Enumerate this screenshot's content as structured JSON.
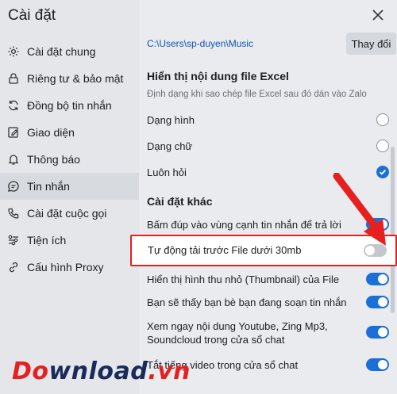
{
  "sidebar": {
    "title": "Cài đặt",
    "items": [
      {
        "label": "Cài đặt chung",
        "icon": "gear-icon"
      },
      {
        "label": "Riêng tư & bảo mật",
        "icon": "lock-icon"
      },
      {
        "label": "Đồng bộ tin nhắn",
        "icon": "sync-icon"
      },
      {
        "label": "Giao diện",
        "icon": "edit-icon"
      },
      {
        "label": "Thông báo",
        "icon": "bell-icon"
      },
      {
        "label": "Tin nhắn",
        "icon": "chat-icon",
        "active": true
      },
      {
        "label": "Cài đặt cuộc gọi",
        "icon": "phone-icon"
      },
      {
        "label": "Tiện ích",
        "icon": "utilities-icon"
      },
      {
        "label": "Cấu hình Proxy",
        "icon": "proxy-icon"
      }
    ]
  },
  "main": {
    "path": "C:\\Users\\sp-duyen\\Music",
    "change_button": "Thay đổi",
    "excel": {
      "title": "Hiển thị nội dung file Excel",
      "desc": "Định dạng khi sao chép file Excel sau đó dán vào Zalo",
      "options": [
        {
          "label": "Dạng hình",
          "checked": false
        },
        {
          "label": "Dạng chữ",
          "checked": false
        },
        {
          "label": "Luôn hỏi",
          "checked": true
        }
      ]
    },
    "other": {
      "title": "Cài đặt khác",
      "items": [
        {
          "label": "Bấm đúp vào vùng cạnh tin nhắn để trả lời",
          "on": true
        },
        {
          "label": "Tự động tải trước File dưới 30mb",
          "on": false
        },
        {
          "label": "Hiển thị hình thu nhỏ (Thumbnail) của File",
          "on": true
        },
        {
          "label": "Bạn sẽ thấy bạn bè bạn đang soạn tin nhắn",
          "on": true
        },
        {
          "label_line1": "Xem ngay nội dung Youtube, Zing Mp3,",
          "label_line2": "Soundcloud trong cửa sổ chat",
          "on": true
        },
        {
          "label": "Tắt tiếng video trong cửa sổ chat",
          "on": true
        }
      ]
    }
  },
  "watermark": {
    "part1": "Do",
    "part2": "wnload",
    "part3": ".vn"
  },
  "colors": {
    "accent": "#1a6fd8",
    "highlight": "#e5201f"
  }
}
